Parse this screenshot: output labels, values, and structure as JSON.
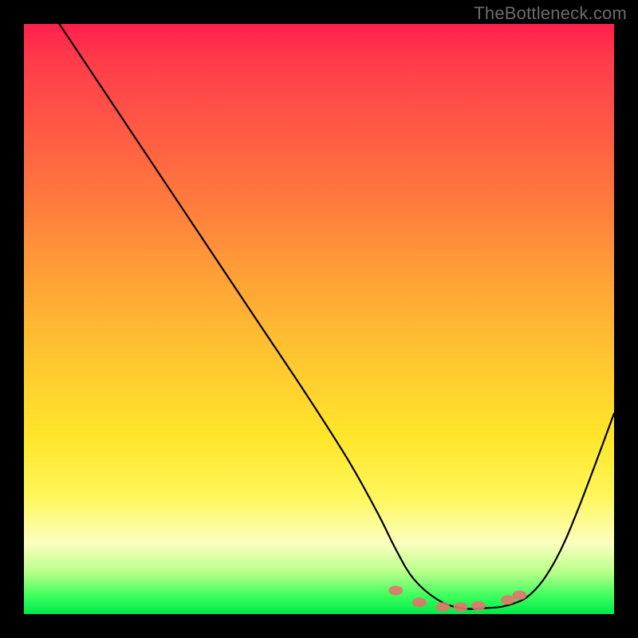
{
  "watermark": "TheBottleneck.com",
  "chart_data": {
    "type": "line",
    "title": "",
    "xlabel": "",
    "ylabel": "",
    "xlim": [
      0,
      100
    ],
    "ylim": [
      0,
      100
    ],
    "grid": false,
    "legend": false,
    "series": [
      {
        "name": "bottleneck-curve",
        "x": [
          6,
          10,
          16,
          24,
          32,
          40,
          48,
          55,
          60,
          63,
          66,
          70,
          74,
          78,
          82,
          86,
          90,
          94,
          100
        ],
        "y": [
          100,
          94,
          85,
          73,
          61,
          49,
          37,
          26,
          17,
          11,
          6,
          2.5,
          1,
          1,
          1.5,
          3.5,
          9,
          18,
          34
        ]
      }
    ],
    "markers": {
      "name": "highlight-dots",
      "points": [
        {
          "x": 63,
          "y": 4
        },
        {
          "x": 67,
          "y": 2
        },
        {
          "x": 71,
          "y": 1.2
        },
        {
          "x": 74,
          "y": 1.2
        },
        {
          "x": 77,
          "y": 1.4
        },
        {
          "x": 82,
          "y": 2.4
        },
        {
          "x": 84,
          "y": 3.2
        }
      ]
    },
    "background_gradient": {
      "top": "#ff1f4e",
      "mid1": "#ffa436",
      "mid2": "#ffe62a",
      "bottom": "#00e84a"
    }
  }
}
